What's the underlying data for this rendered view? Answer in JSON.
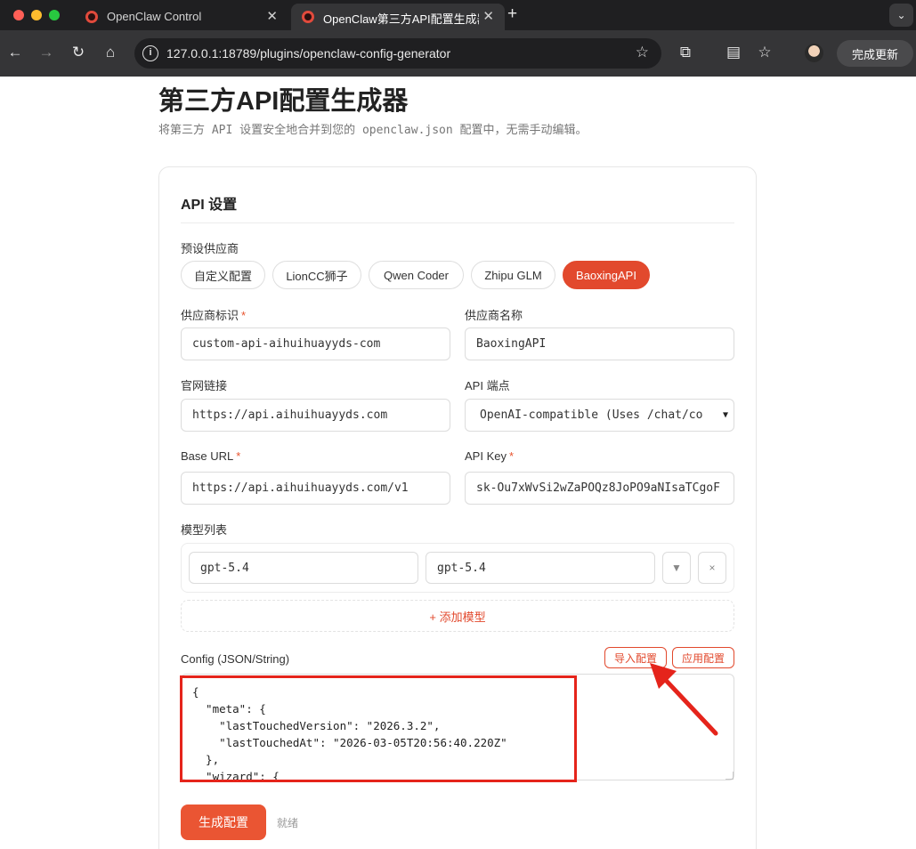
{
  "browser": {
    "tabs": [
      {
        "title": "OpenClaw Control",
        "active": false
      },
      {
        "title": "OpenClaw第三方API配置生成器",
        "active": true
      }
    ],
    "url": "127.0.0.1:18789/plugins/openclaw-config-generator",
    "update_label": "完成更新"
  },
  "page": {
    "title": "第三方API配置生成器",
    "subtitle": "将第三方 API 设置安全地合并到您的 openclaw.json 配置中，无需手动编辑。"
  },
  "card": {
    "title": "API 设置",
    "preset_label": "预设供应商",
    "presets": [
      "自定义配置",
      "LionCC狮子",
      "Qwen Coder",
      "Zhipu GLM",
      "BaoxingAPI"
    ],
    "active_preset": "BaoxingAPI",
    "fields": {
      "provider_id": {
        "label": "供应商标识",
        "required": "*",
        "value": "custom-api-aihuihuayyds-com"
      },
      "provider_name": {
        "label": "供应商名称",
        "value": "BaoxingAPI"
      },
      "website": {
        "label": "官网链接",
        "value": "https://api.aihuihuayyds.com"
      },
      "endpoint": {
        "label": "API 端点",
        "value": "OpenAI-compatible (Uses /chat/co"
      },
      "base_url": {
        "label": "Base URL",
        "required": "*",
        "value": "https://api.aihuihuayyds.com/v1"
      },
      "api_key": {
        "label": "API Key",
        "required": "*",
        "value": "sk-Ou7xWvSi2wZaPOQz8JoPO9aNIsaTCgoF"
      }
    },
    "models_label": "模型列表",
    "models": [
      {
        "id": "gpt-5.4",
        "name": "gpt-5.4"
      }
    ],
    "move_glyph": "▼",
    "remove_glyph": "×",
    "add_model_label": "+ 添加模型",
    "config_label": "Config (JSON/String)",
    "import_label": "导入配置",
    "apply_label": "应用配置",
    "config_text": "{\n  \"meta\": {\n    \"lastTouchedVersion\": \"2026.3.2\",\n    \"lastTouchedAt\": \"2026-03-05T20:56:40.220Z\"\n  },\n  \"wizard\": {",
    "generate_label": "生成配置",
    "status": "就绪"
  },
  "colors": {
    "accent": "#e2492d",
    "annotation": "#e5241b"
  }
}
